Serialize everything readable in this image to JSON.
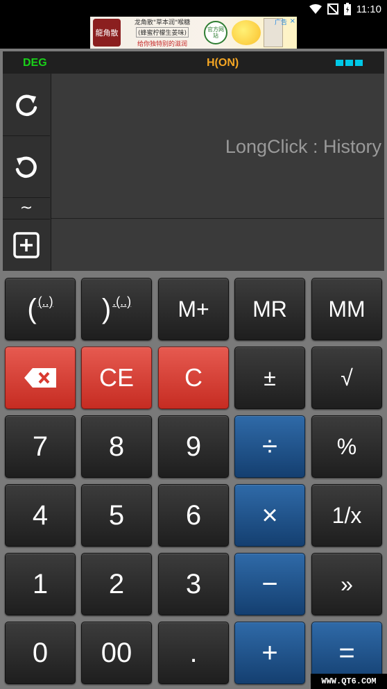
{
  "status_bar": {
    "time": "11:10"
  },
  "ad": {
    "logo": "龍角散",
    "brand": "龍角散",
    "line1": "龙角散\"草本润\"喉糖",
    "line2": "(蜂蜜柠檬生姜味)",
    "line3": "给你独特别的滋润",
    "badge": "官方网站",
    "tag": "广告",
    "close": "×"
  },
  "mode": {
    "angle": "DEG",
    "history": "H(ON)"
  },
  "display": {
    "hint": "LongClick : History"
  },
  "side_buttons": {
    "tilde": "~"
  },
  "keys": {
    "open_paren": "(",
    "open_paren_sup": "(..)",
    "close_paren": ")",
    "close_paren_sup": ".(..)",
    "m_plus": "M+",
    "mr": "MR",
    "mm": "MM",
    "ce": "CE",
    "c": "C",
    "plus_minus": "±",
    "sqrt": "√",
    "seven": "7",
    "eight": "8",
    "nine": "9",
    "divide": "÷",
    "percent": "%",
    "four": "4",
    "five": "5",
    "six": "6",
    "multiply": "×",
    "reciprocal": "1/x",
    "one": "1",
    "two": "2",
    "three": "3",
    "minus": "−",
    "forward": "»",
    "zero": "0",
    "double_zero": "00",
    "decimal": ".",
    "plus": "+",
    "equals": "="
  },
  "watermark": "WWW.QT6.COM",
  "colors": {
    "deg": "#19d119",
    "history": "#f5a623",
    "indicator": "#00c8e6",
    "red_key": "#d93a30",
    "blue_key": "#1f5189"
  }
}
